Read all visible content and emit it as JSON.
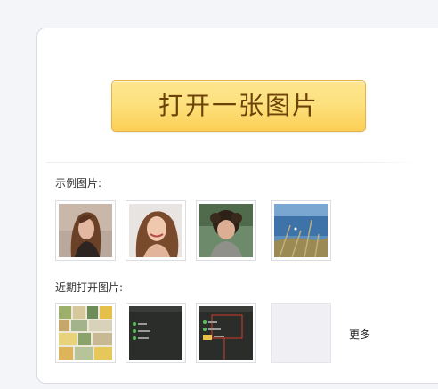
{
  "open_button_label": "打开一张图片",
  "examples": {
    "label": "示例图片:",
    "images": [
      {
        "name": "woman-portrait-thumbnail"
      },
      {
        "name": "smiling-woman-thumbnail"
      },
      {
        "name": "child-portrait-thumbnail"
      },
      {
        "name": "grass-sea-thumbnail"
      }
    ]
  },
  "recent": {
    "label": "近期打开图片:",
    "images": [
      {
        "name": "collage-thumbnail"
      },
      {
        "name": "dark-menu-screenshot-thumbnail"
      },
      {
        "name": "dark-menu-annotated-thumbnail"
      },
      {
        "name": "empty-thumbnail"
      }
    ],
    "more_label": "更多"
  }
}
